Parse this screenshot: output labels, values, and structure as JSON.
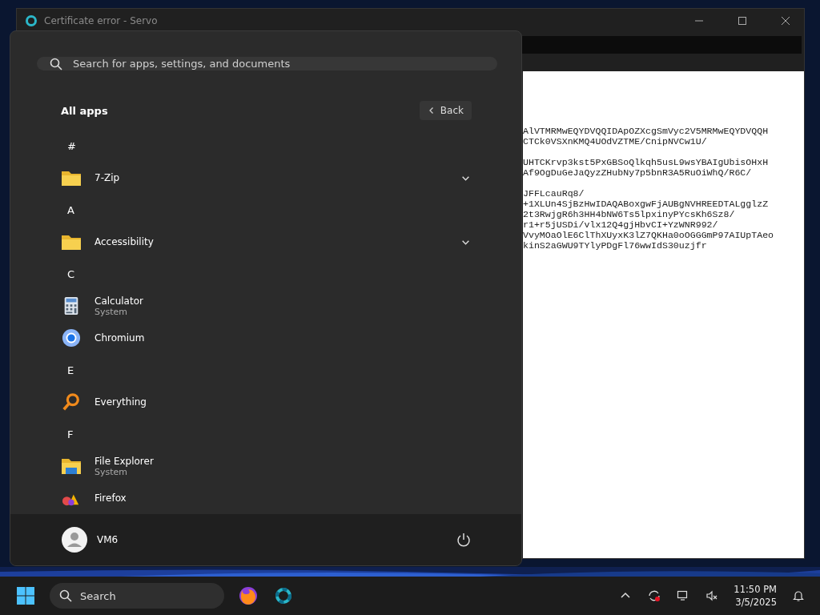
{
  "browser_window": {
    "title": "Certificate error - Servo",
    "certificate_text": [
      [
        "AlVTMRMwEQYDVQQIDApOZXcgSmVyc2V5MRMwEQYDVQQH",
        "CTCk0VSXnKMQ4UOdVZTME/CnipNVCw1U/"
      ],
      [
        "UHTCKrvp3kst5PxGBSoQlkqh5usL9wsYBAIgUbisOHxH",
        "Af9OgDuGeJaQyzZHubNy7p5bnR3A5RuOiWhQ/R6C/"
      ],
      [
        "JFFLcauRq8/",
        "+1XLUn4SjBzHwIDAQABoxgwFjAUBgNVHREEDTALgglzZ",
        "2t3RwjgR6h3HH4bNW6Ts5lpxinyPYcsKh6Sz8/",
        "r1+r5jUSDi/vlx12Q4gjHbvCI+YzWNR992/",
        "VvyMOaOlE6ClThXUyxK3lZ7QKHa0oOGGGmP97AIUpTAeo",
        "kinS2aGWU9TYlyPDgFl76wwIdS30uzjfr"
      ]
    ]
  },
  "start_menu": {
    "search": {
      "placeholder": "Search for apps, settings, and documents"
    },
    "heading": "All apps",
    "back_button": "Back",
    "items": [
      {
        "kind": "header",
        "label": "#"
      },
      {
        "kind": "folder",
        "label": "7-Zip",
        "expanded": false
      },
      {
        "kind": "header",
        "label": "A"
      },
      {
        "kind": "folder",
        "label": "Accessibility",
        "expanded": false
      },
      {
        "kind": "header",
        "label": "C"
      },
      {
        "kind": "calculator",
        "label": "Calculator",
        "subtitle": "System"
      },
      {
        "kind": "chromium",
        "label": "Chromium"
      },
      {
        "kind": "header",
        "label": "E"
      },
      {
        "kind": "everything",
        "label": "Everything"
      },
      {
        "kind": "header",
        "label": "F"
      },
      {
        "kind": "explorer",
        "label": "File Explorer",
        "subtitle": "System"
      },
      {
        "kind": "firefox",
        "label": "Firefox"
      }
    ],
    "user": "VM6"
  },
  "taskbar": {
    "search": "Search",
    "time": "11:50 PM",
    "date": "3/5/2025"
  }
}
